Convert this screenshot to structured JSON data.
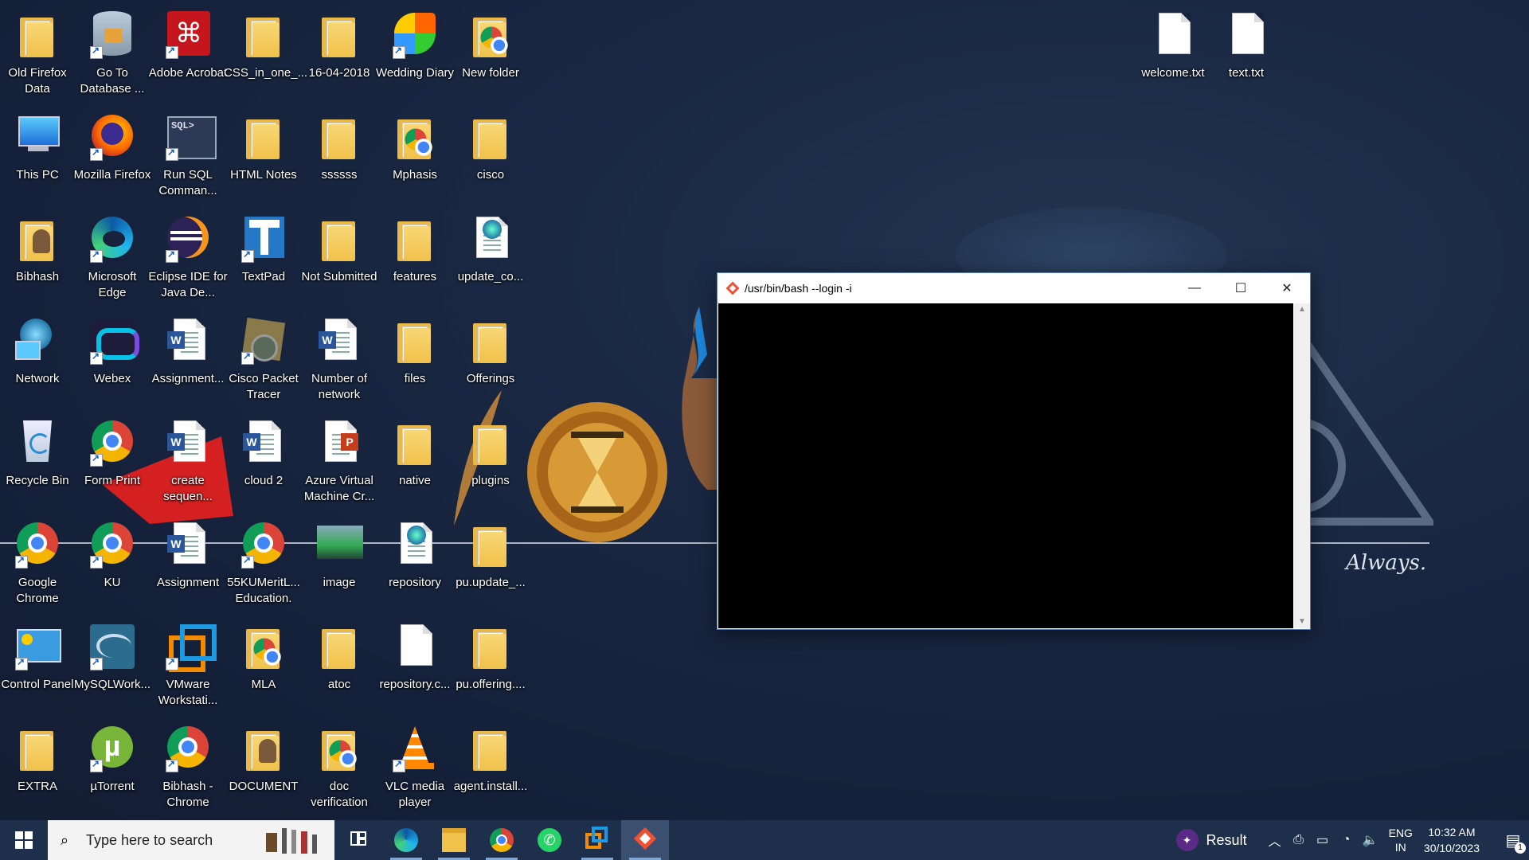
{
  "desktop": {
    "icons": [
      {
        "label": "Old Firefox Data",
        "kind": "folder"
      },
      {
        "label": "Go To Database ...",
        "kind": "database"
      },
      {
        "label": "Adobe Acrobat",
        "kind": "acrobat"
      },
      {
        "label": "CSS_in_one_...",
        "kind": "folder"
      },
      {
        "label": "16-04-2018",
        "kind": "folder"
      },
      {
        "label": "Wedding Diary",
        "kind": "msn"
      },
      {
        "label": "New folder",
        "kind": "folder-chrome"
      },
      {
        "label": "This PC",
        "kind": "pc"
      },
      {
        "label": "Mozilla Firefox",
        "kind": "firefox"
      },
      {
        "label": "Run SQL Comman...",
        "kind": "sql"
      },
      {
        "label": "HTML Notes",
        "kind": "folder"
      },
      {
        "label": "ssssss",
        "kind": "folder"
      },
      {
        "label": "Mphasis",
        "kind": "folder-chrome"
      },
      {
        "label": "cisco",
        "kind": "folder"
      },
      {
        "label": "Bibhash",
        "kind": "user-folder"
      },
      {
        "label": "Microsoft Edge",
        "kind": "edge"
      },
      {
        "label": "Eclipse IDE for Java De...",
        "kind": "eclipse"
      },
      {
        "label": "TextPad",
        "kind": "textpad"
      },
      {
        "label": "Not Submitted",
        "kind": "folder"
      },
      {
        "label": "features",
        "kind": "folder"
      },
      {
        "label": "update_co...",
        "kind": "web-doc"
      },
      {
        "label": "Network",
        "kind": "network"
      },
      {
        "label": "Webex",
        "kind": "webex"
      },
      {
        "label": "Assignment...",
        "kind": "word"
      },
      {
        "label": "Cisco Packet Tracer",
        "kind": "packet-tracer"
      },
      {
        "label": "Number of network",
        "kind": "word"
      },
      {
        "label": "files",
        "kind": "folder"
      },
      {
        "label": "Offerings",
        "kind": "folder"
      },
      {
        "label": "Recycle Bin",
        "kind": "recycle-bin"
      },
      {
        "label": "Form Print",
        "kind": "chrome"
      },
      {
        "label": "create sequen...",
        "kind": "word"
      },
      {
        "label": "cloud 2",
        "kind": "word"
      },
      {
        "label": "Azure Virtual Machine Cr...",
        "kind": "powerpoint"
      },
      {
        "label": "native",
        "kind": "folder"
      },
      {
        "label": "plugins",
        "kind": "folder"
      },
      {
        "label": "Google Chrome",
        "kind": "chrome"
      },
      {
        "label": "KU",
        "kind": "chrome"
      },
      {
        "label": "Assignment",
        "kind": "word"
      },
      {
        "label": "55KUMeritL... Education.",
        "kind": "chrome"
      },
      {
        "label": "image",
        "kind": "image"
      },
      {
        "label": "repository",
        "kind": "web-doc"
      },
      {
        "label": "pu.update_...",
        "kind": "folder"
      },
      {
        "label": "Control Panel",
        "kind": "control-panel"
      },
      {
        "label": "MySQLWork...",
        "kind": "mysql"
      },
      {
        "label": "VMware Workstati...",
        "kind": "vmware"
      },
      {
        "label": "MLA",
        "kind": "folder-chrome"
      },
      {
        "label": "atoc",
        "kind": "folder"
      },
      {
        "label": "repository.c...",
        "kind": "blank-doc"
      },
      {
        "label": "pu.offering....",
        "kind": "folder"
      },
      {
        "label": "EXTRA",
        "kind": "folder"
      },
      {
        "label": "µTorrent",
        "kind": "utorrent"
      },
      {
        "label": "Bibhash - Chrome",
        "kind": "chrome"
      },
      {
        "label": "DOCUMENT",
        "kind": "user-folder"
      },
      {
        "label": "doc verification",
        "kind": "folder-chrome"
      },
      {
        "label": "VLC media player",
        "kind": "vlc"
      },
      {
        "label": "agent.install...",
        "kind": "folder"
      },
      {
        "label": "welcome.txt",
        "kind": "blank-doc"
      },
      {
        "label": "text.txt",
        "kind": "blank-doc"
      }
    ],
    "wallpaper_caption": "Always."
  },
  "terminal": {
    "title": "/usr/bin/bash --login -i",
    "minimize": "—",
    "maximize": "☐",
    "close": "✕"
  },
  "taskbar": {
    "search_placeholder": "Type here to search",
    "pinned": [
      {
        "name": "Task View",
        "icon": "task-view-icon"
      },
      {
        "name": "Microsoft Edge",
        "icon": "edge-icon"
      },
      {
        "name": "File Explorer",
        "icon": "file-explorer-icon"
      },
      {
        "name": "Google Chrome",
        "icon": "chrome-icon"
      },
      {
        "name": "WhatsApp",
        "icon": "whatsapp-icon"
      },
      {
        "name": "VMware",
        "icon": "vmware-icon"
      },
      {
        "name": "Git Bash",
        "icon": "git-icon"
      }
    ],
    "result_label": "Result",
    "lang_line1": "ENG",
    "lang_line2": "IN",
    "time": "10:32 AM",
    "date": "30/10/2023",
    "notification_count": "1"
  }
}
